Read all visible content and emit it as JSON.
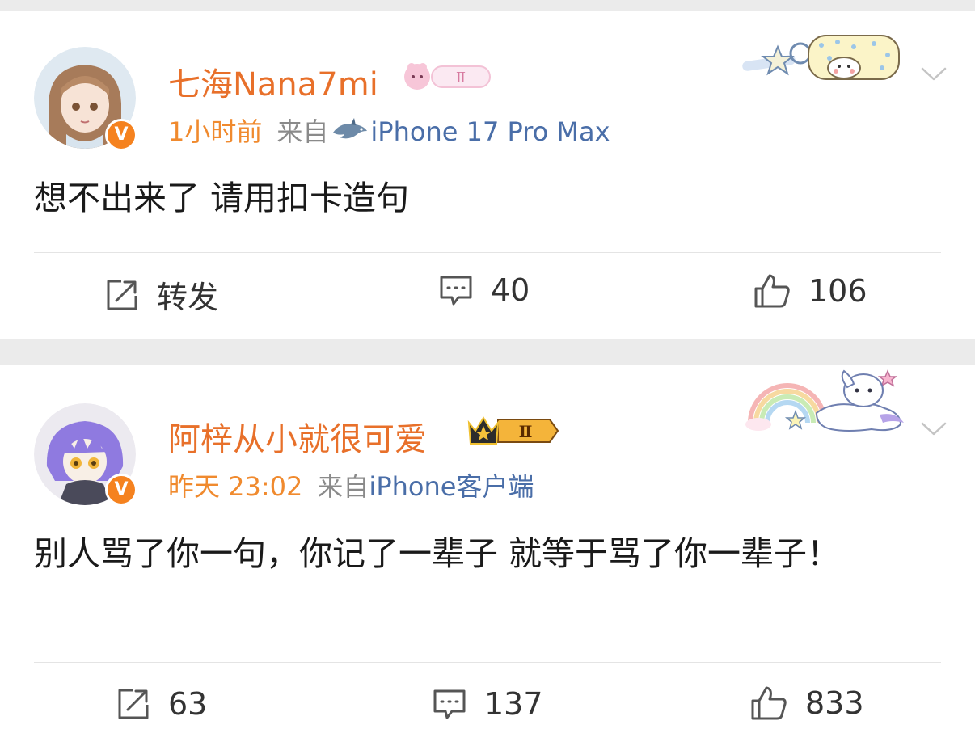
{
  "posts": [
    {
      "author": "七海Nana7mi",
      "level_badge": "Ⅱ",
      "time": "1小时前",
      "source_prefix": "来自",
      "device": "iPhone 17 Pro Max",
      "verified_badge": "V",
      "content": "想不出来了 请用扣卡造句",
      "actions": {
        "repost": "转发",
        "comments": "40",
        "likes": "106"
      }
    },
    {
      "author": "阿梓从小就很可爱",
      "level_badge": "Ⅱ",
      "time": "昨天 23:02",
      "source_prefix": "来自",
      "device": "iPhone客户端",
      "verified_badge": "V",
      "content": "别人骂了你一句，你记了一辈子 就等于骂了你一辈子！",
      "actions": {
        "repost": "63",
        "comments": "137",
        "likes": "833"
      }
    }
  ],
  "colors": {
    "author": "#e8702a",
    "time": "#f08a2e",
    "source": "#8a8a8a",
    "device": "#4a6ea8",
    "verified": "#f5821f",
    "separator": "#ebebeb"
  },
  "icons": [
    "repost-icon",
    "comment-icon",
    "like-icon",
    "chevron-down-icon",
    "dolphin-icon"
  ]
}
